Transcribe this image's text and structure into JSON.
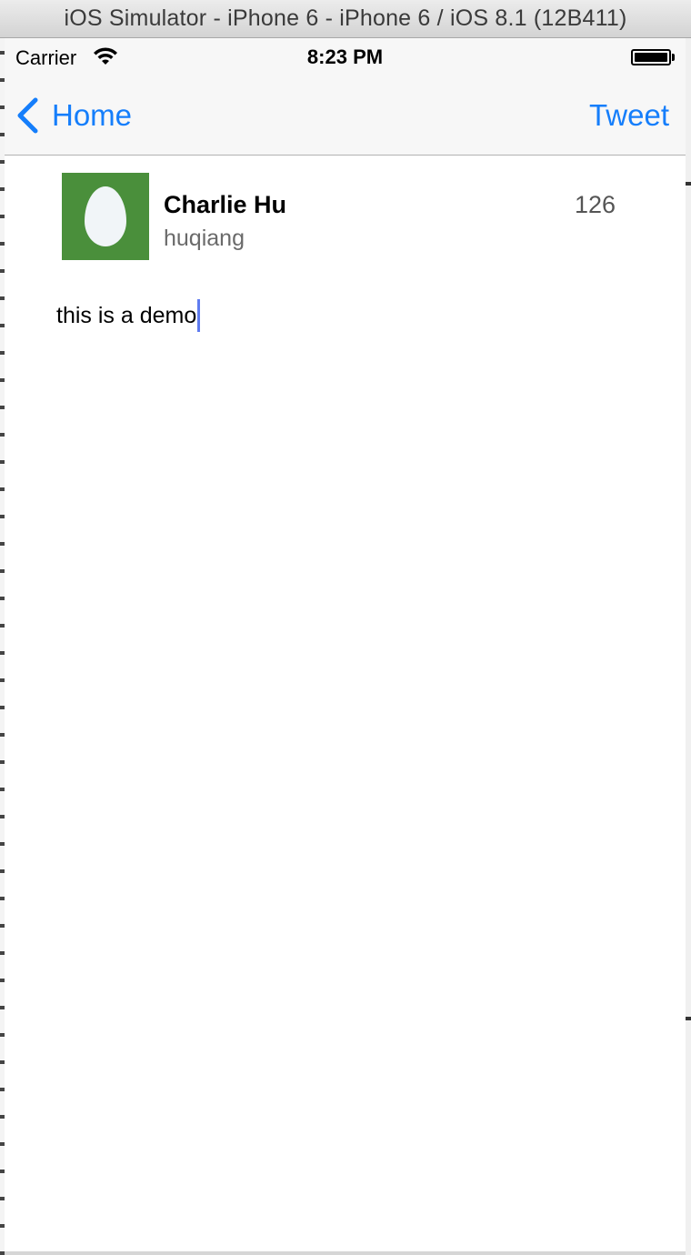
{
  "window": {
    "title": "iOS Simulator - iPhone 6 - iPhone 6 / iOS 8.1 (12B411)"
  },
  "status_bar": {
    "carrier": "Carrier",
    "time": "8:23 PM",
    "wifi_icon": "wifi-icon",
    "battery_icon": "battery-icon"
  },
  "nav_bar": {
    "back_label": "Home",
    "back_icon": "chevron-left-icon",
    "action_label": "Tweet",
    "tint_color": "#157efb"
  },
  "compose": {
    "user_name": "Charlie Hu",
    "user_handle": "huqiang",
    "char_count": "126",
    "text": "this is a demo",
    "avatar_color": "#4a8f3b",
    "avatar_icon": "egg-avatar-icon"
  }
}
